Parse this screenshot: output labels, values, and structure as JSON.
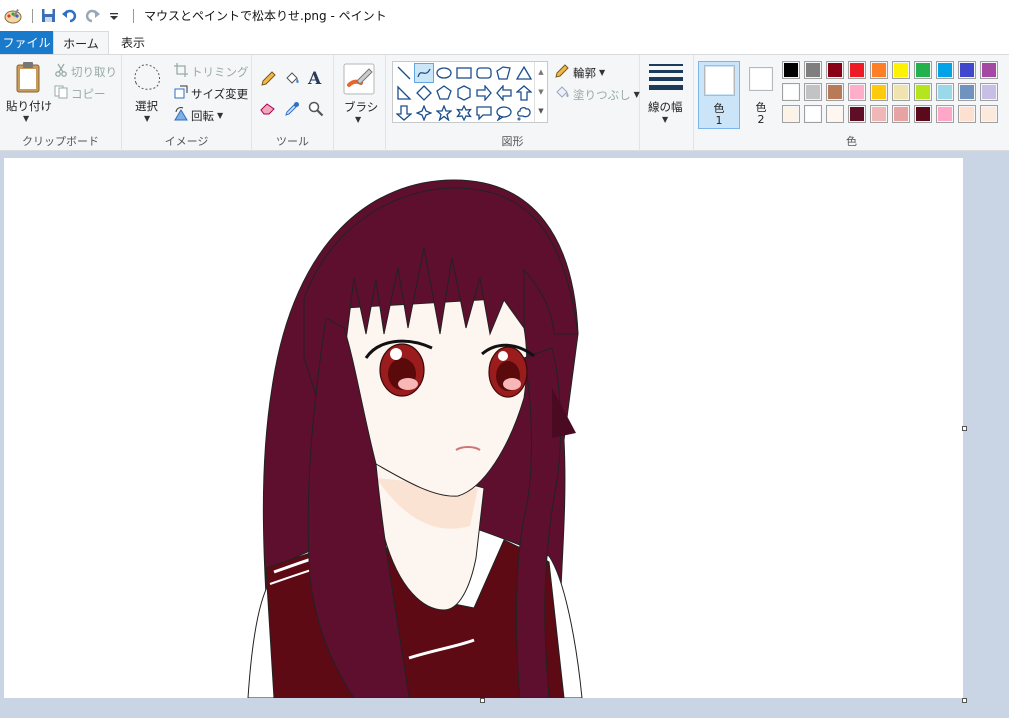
{
  "window": {
    "title": "マウスとペイントで松本りせ.png - ペイント"
  },
  "tabs": {
    "file": "ファイル",
    "home": "ホーム",
    "view": "表示"
  },
  "clipboard": {
    "paste": "貼り付け",
    "cut": "切り取り",
    "copy": "コピー",
    "label": "クリップボード"
  },
  "image": {
    "select": "選択",
    "crop": "トリミング",
    "resize": "サイズ変更",
    "rotate": "回転",
    "label": "イメージ"
  },
  "tools": {
    "label": "ツール"
  },
  "brushes": {
    "label": "ブラシ"
  },
  "shapes": {
    "outline": "輪郭",
    "fill": "塗りつぶし",
    "label": "図形"
  },
  "size": {
    "label": "線の幅"
  },
  "colors": {
    "color1_label": "色",
    "color1_num": "1",
    "color2_label": "色",
    "color2_num": "2",
    "label": "色",
    "color1": "#ffffff",
    "color2": "#ffffff",
    "palette": [
      [
        "#000000",
        "#7f7f7f",
        "#880015",
        "#ed1c24",
        "#ff7f27",
        "#fff200",
        "#22b14c",
        "#00a2e8",
        "#3f48cc",
        "#a349a4"
      ],
      [
        "#ffffff",
        "#c3c3c3",
        "#b97a57",
        "#ffaec9",
        "#ffc90e",
        "#efe4b0",
        "#b5e61d",
        "#99d9ea",
        "#7092be",
        "#c8bfe7"
      ],
      [
        "#fdf2e6",
        "#ffffff",
        "#fdf7f0",
        "#5e0f26",
        "#f0b7b7",
        "#e7a3a3",
        "#5a0a1a",
        "#ffa6c9",
        "#fde0d0",
        "#fde9dc"
      ]
    ]
  },
  "drawing": {
    "hair": "#5e0f2e",
    "hair_dark": "#4a0a22",
    "skin": "#fdf6f0",
    "skin_shadow": "#fbe3d3",
    "uniform": "#5e0a14",
    "eye": "#9b1c1c"
  }
}
